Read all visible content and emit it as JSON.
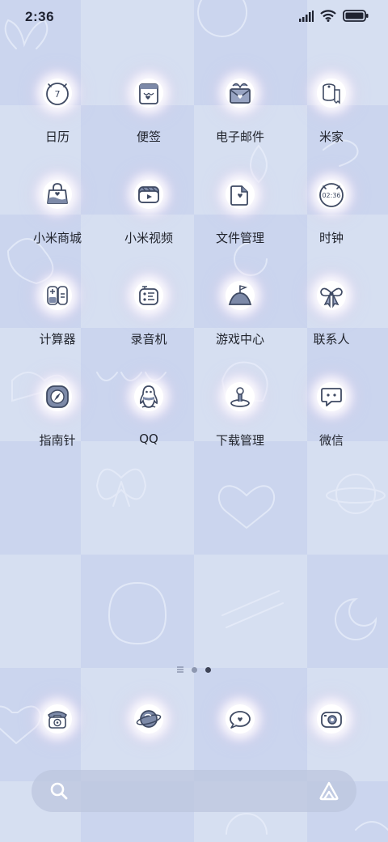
{
  "status_bar": {
    "time": "2:36",
    "icons": [
      "signal-icon",
      "wifi-icon",
      "battery-icon"
    ]
  },
  "apps": [
    {
      "label": "日历",
      "icon": "calendar-icon",
      "badge_text": "7"
    },
    {
      "label": "便签",
      "icon": "notes-icon"
    },
    {
      "label": "电子邮件",
      "icon": "mail-icon"
    },
    {
      "label": "米家",
      "icon": "mijia-icon"
    },
    {
      "label": "小米商城",
      "icon": "shop-bag-icon"
    },
    {
      "label": "小米视频",
      "icon": "video-icon"
    },
    {
      "label": "文件管理",
      "icon": "folder-icon"
    },
    {
      "label": "时钟",
      "icon": "clock-icon",
      "badge_text": "02:36"
    },
    {
      "label": "计算器",
      "icon": "calculator-icon"
    },
    {
      "label": "录音机",
      "icon": "recorder-icon"
    },
    {
      "label": "游戏中心",
      "icon": "game-center-icon"
    },
    {
      "label": "联系人",
      "icon": "bow-icon"
    },
    {
      "label": "指南针",
      "icon": "compass-icon"
    },
    {
      "label": "QQ",
      "icon": "qq-penguin-icon"
    },
    {
      "label": "下载管理",
      "icon": "download-icon"
    },
    {
      "label": "微信",
      "icon": "wechat-icon"
    }
  ],
  "page_indicator": {
    "pages": 3,
    "current": 3
  },
  "dock": [
    {
      "icon": "phone-icon"
    },
    {
      "icon": "browser-planet-icon"
    },
    {
      "icon": "message-icon"
    },
    {
      "icon": "camera-icon"
    }
  ],
  "search_bar": {
    "left_icon": "search-icon",
    "right_icon": "assistant-icon"
  },
  "colors": {
    "bg_light": "#dbe3f3",
    "bg_dark": "#c9d4ee",
    "icon_stroke": "#3f4a63",
    "label": "#22252e"
  }
}
